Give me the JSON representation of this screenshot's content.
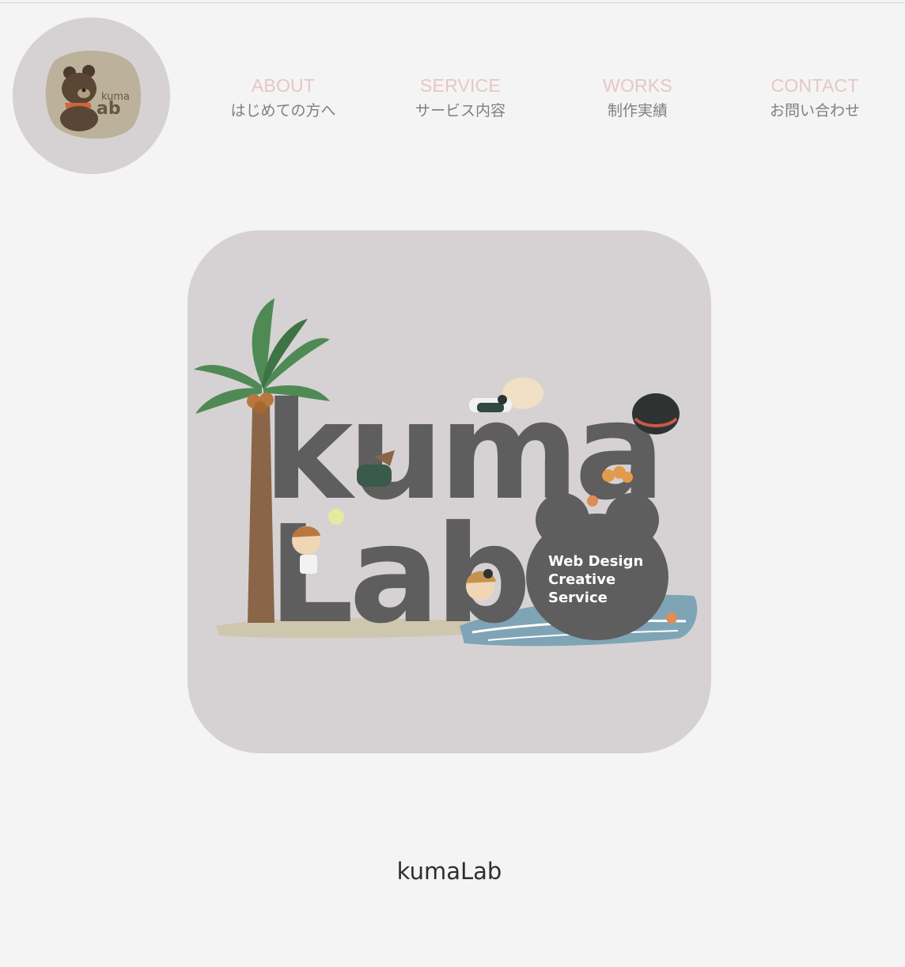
{
  "logo": {
    "alt": "kuma Lab",
    "icon": "bear-logo-icon"
  },
  "nav": {
    "items": [
      {
        "en": "ABOUT",
        "jp": "はじめての方へ"
      },
      {
        "en": "SERVICE",
        "jp": "サービス内容"
      },
      {
        "en": "WORKS",
        "jp": "制作実績"
      },
      {
        "en": "CONTACT",
        "jp": "お問い合わせ"
      }
    ]
  },
  "hero": {
    "tagline": [
      "Web Design",
      "Creative",
      "Service"
    ]
  },
  "caption": "kumaLab",
  "colors": {
    "background": "#f4f4f4",
    "card": "#d6d2d3",
    "nav_en": "#e7c6c7",
    "nav_jp": "#7f7f7f",
    "letters": "#5e5e5e",
    "palm_leaf": "#4f8a55",
    "trunk": "#8a6547",
    "water": "#7fa4b6"
  }
}
